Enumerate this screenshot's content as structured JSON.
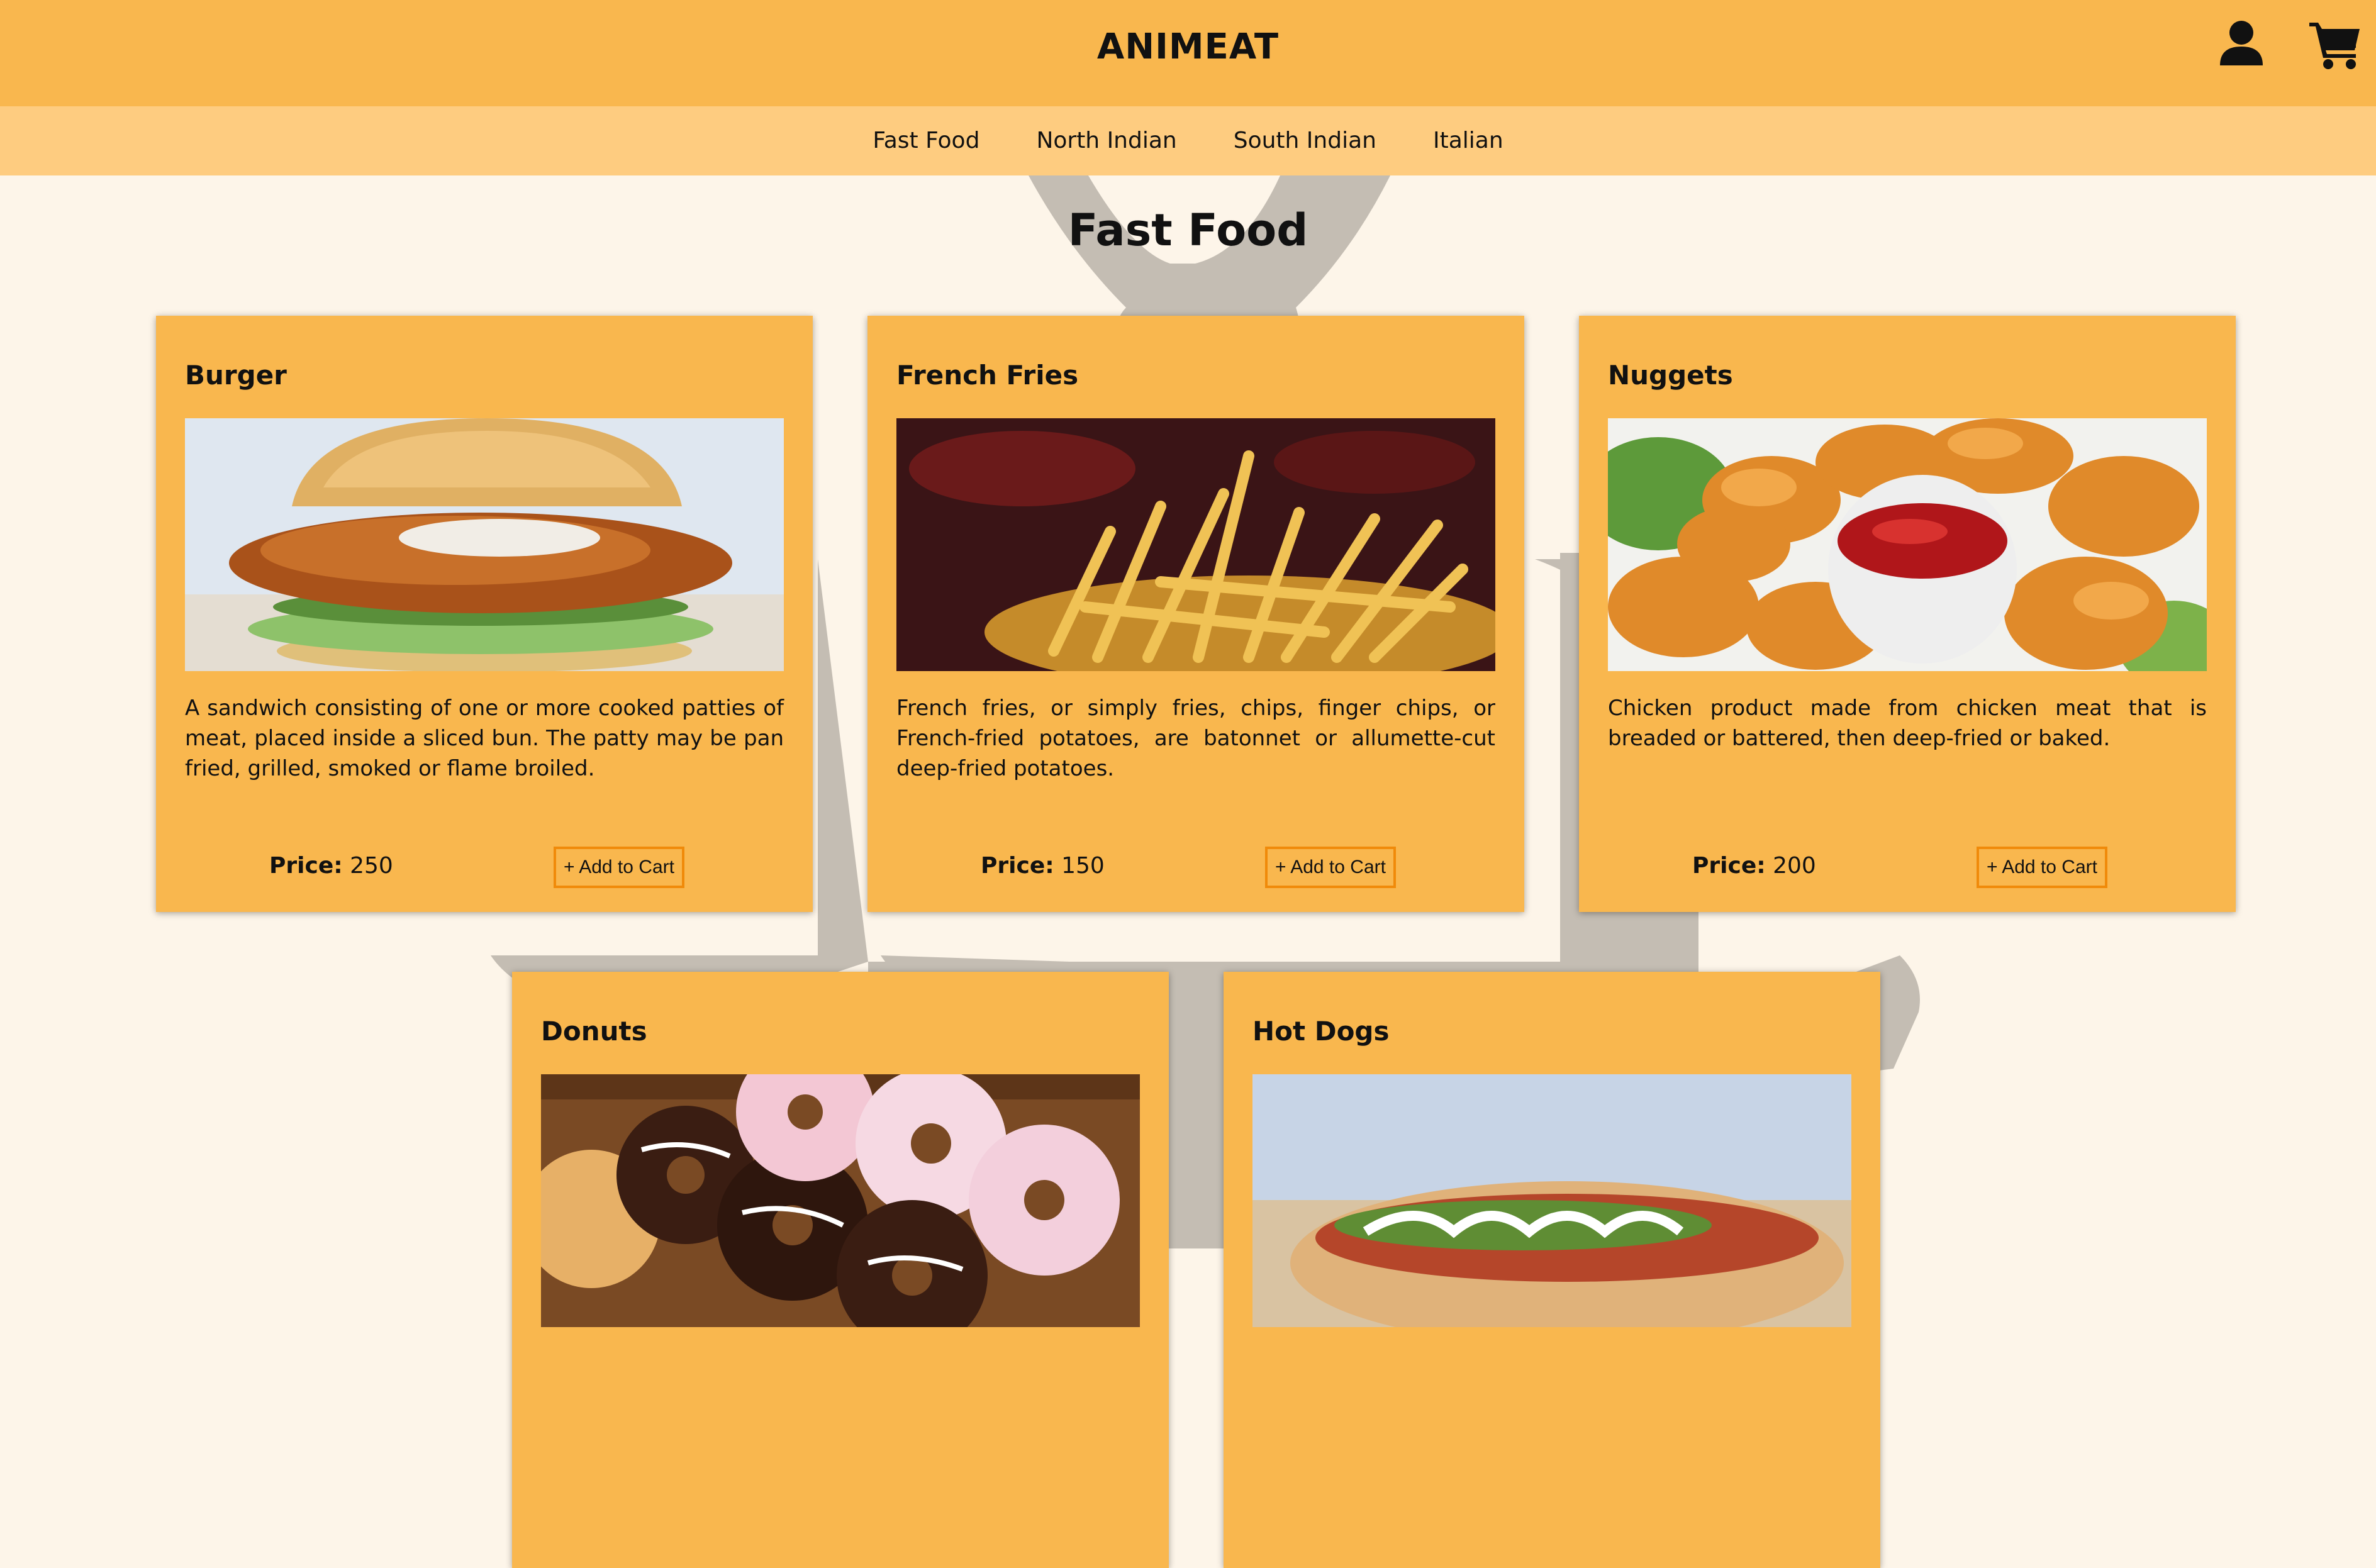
{
  "header": {
    "logo": "ANIMEAT",
    "user_icon": "user-icon",
    "cart_icon": "cart-icon"
  },
  "nav": {
    "categories": [
      "Fast Food",
      "North Indian",
      "South Indian",
      "Italian"
    ]
  },
  "section": {
    "title": "Fast Food"
  },
  "items": [
    {
      "name": "Burger",
      "description": "A sandwich consisting of one or more cooked patties of meat, placed inside a sliced bun. The patty may be pan fried, grilled, smoked or flame broiled.",
      "price_label": "Price:",
      "price": "250",
      "button": "+ Add to Cart"
    },
    {
      "name": "French Fries",
      "description": "French fries, or simply fries, chips, finger chips, or French-fried potatoes, are batonnet or allumette-cut deep-fried potatoes.",
      "price_label": "Price:",
      "price": "150",
      "button": "+ Add to Cart"
    },
    {
      "name": "Nuggets",
      "description": "Chicken product made from chicken meat that is breaded or battered, then deep-fried or baked.",
      "price_label": "Price:",
      "price": "200",
      "button": "+ Add to Cart"
    },
    {
      "name": "Donuts"
    },
    {
      "name": "Hot Dogs"
    }
  ],
  "colors": {
    "header": "#f9b74e",
    "nav": "#fecc80",
    "background": "#fdf5e9",
    "card": "#f9b74e",
    "button_border": "#f08a0a",
    "mascot": "#c4bdb3"
  }
}
